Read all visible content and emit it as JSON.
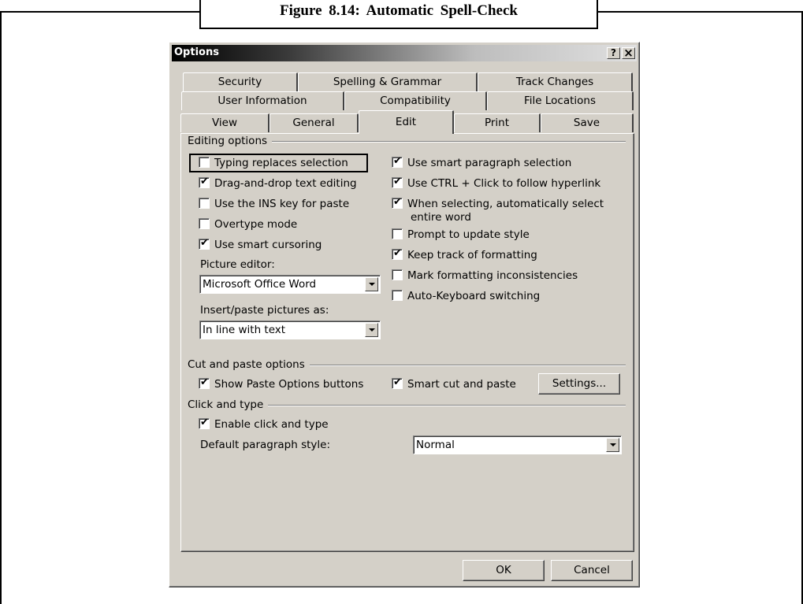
{
  "caption": "Figure 8.14: Automatic Spell-Check",
  "dialog": {
    "title": "Options",
    "help_btn": "?",
    "close_btn": "×"
  },
  "tabs": {
    "row1": [
      "Security",
      "Spelling & Grammar",
      "Track Changes"
    ],
    "row2": [
      "User Information",
      "Compatibility",
      "File Locations"
    ],
    "row3": [
      "View",
      "General",
      "Edit",
      "Print",
      "Save"
    ],
    "active": "Edit"
  },
  "editing": {
    "heading": "Editing options",
    "left": [
      {
        "label": "Typing replaces selection",
        "checked": false
      },
      {
        "label": "Drag-and-drop text editing",
        "checked": true
      },
      {
        "label": "Use the INS key for paste",
        "checked": false
      },
      {
        "label": "Overtype mode",
        "checked": false
      },
      {
        "label": "Use smart cursoring",
        "checked": true
      }
    ],
    "right": [
      {
        "label": "Use smart paragraph selection",
        "checked": true
      },
      {
        "label": "Use CTRL + Click to follow hyperlink",
        "checked": true
      },
      {
        "label": "When selecting, automatically select",
        "label2": "entire word",
        "checked": true
      },
      {
        "label": "Prompt to update style",
        "checked": false
      },
      {
        "label": "Keep track of formatting",
        "checked": true
      },
      {
        "label": "Mark formatting inconsistencies",
        "checked": false
      },
      {
        "label": "Auto-Keyboard switching",
        "checked": false
      }
    ],
    "picture_editor_label": "Picture editor:",
    "picture_editor_value": "Microsoft Office Word",
    "insert_pictures_label": "Insert/paste pictures as:",
    "insert_pictures_value": "In line with text"
  },
  "cutpaste": {
    "heading": "Cut and paste options",
    "show_paste": {
      "label": "Show Paste Options buttons",
      "checked": true
    },
    "smart_cut": {
      "label": "Smart cut and paste",
      "checked": true
    },
    "settings_btn": "Settings..."
  },
  "clicktype": {
    "heading": "Click and type",
    "enable": {
      "label": "Enable click and type",
      "checked": true
    },
    "default_style_label": "Default paragraph style:",
    "default_style_value": "Normal"
  },
  "buttons": {
    "ok": "OK",
    "cancel": "Cancel"
  },
  "check_mark": "✔"
}
